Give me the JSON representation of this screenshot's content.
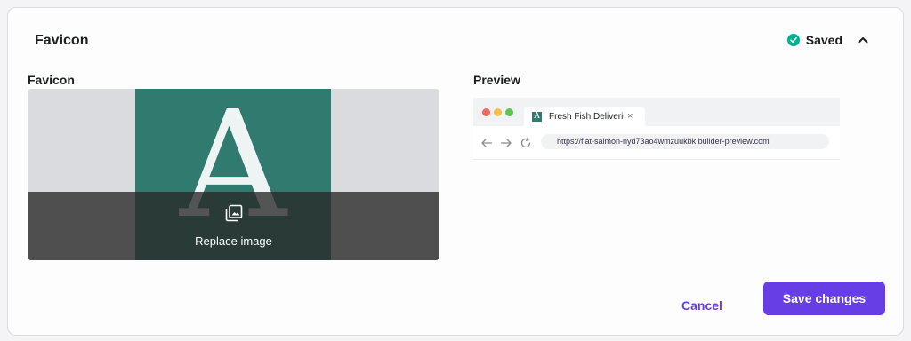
{
  "header": {
    "title": "Favicon",
    "status_label": "Saved",
    "status_icon": "check-circle-icon",
    "collapse_icon": "chevron-up-icon"
  },
  "favicon_section": {
    "label": "Favicon",
    "image_letter": "A",
    "replace_label": "Replace image",
    "replace_icon": "image-gallery-icon"
  },
  "preview_section": {
    "label": "Preview",
    "tab_favicon_letter": "A",
    "tab_title": "Fresh Fish Deliveries",
    "tab_close": "×",
    "url": "https://flat-salmon-nyd73ao4wmzuukbk.builder-preview.com",
    "nav_icons": [
      "arrow-back-icon",
      "arrow-forward-icon",
      "reload-icon"
    ]
  },
  "actions": {
    "cancel_label": "Cancel",
    "save_label": "Save changes"
  },
  "colors": {
    "accent": "#673de6",
    "favicon_bg": "#317a6f",
    "success": "#00b090",
    "window_dot_red": "#ee6a5f",
    "window_dot_yellow": "#f5bd4f",
    "window_dot_green": "#61c454"
  }
}
